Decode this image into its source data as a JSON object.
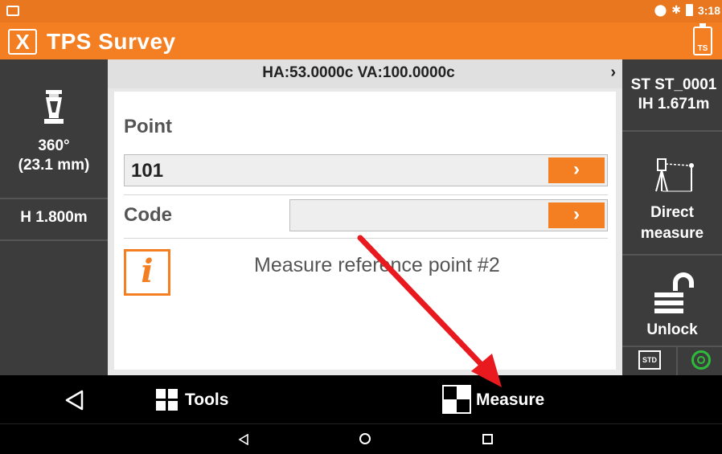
{
  "statusbar": {
    "time": "3:18"
  },
  "app": {
    "title": "TPS Survey",
    "logo_letter": "X",
    "ts_badge": "TS"
  },
  "left_panel": {
    "prism_angle": "360°",
    "prism_constant": "(23.1 mm)",
    "target_height": "H 1.800m"
  },
  "header": {
    "angles": "HA:53.0000c  VA:100.0000c",
    "chevron": "›"
  },
  "form": {
    "point_label": "Point",
    "point_value": "101",
    "code_label": "Code",
    "code_value": "",
    "arrow_glyph": "›",
    "info_glyph": "i",
    "info_message": "Measure reference point #2"
  },
  "right_panel": {
    "station": "ST ST_0001",
    "instrument_height": "IH 1.671m",
    "direct_measure_line1": "Direct",
    "direct_measure_line2": "measure",
    "unlock_label": "Unlock",
    "std_label": "STD"
  },
  "toolbar": {
    "tools_label": "Tools",
    "measure_label": "Measure"
  },
  "colors": {
    "accent": "#f47f22",
    "statusbar": "#e8771f",
    "panel": "#3c3c3c",
    "gps_ok": "#2ebd3a",
    "annotation": "#e8191f"
  }
}
